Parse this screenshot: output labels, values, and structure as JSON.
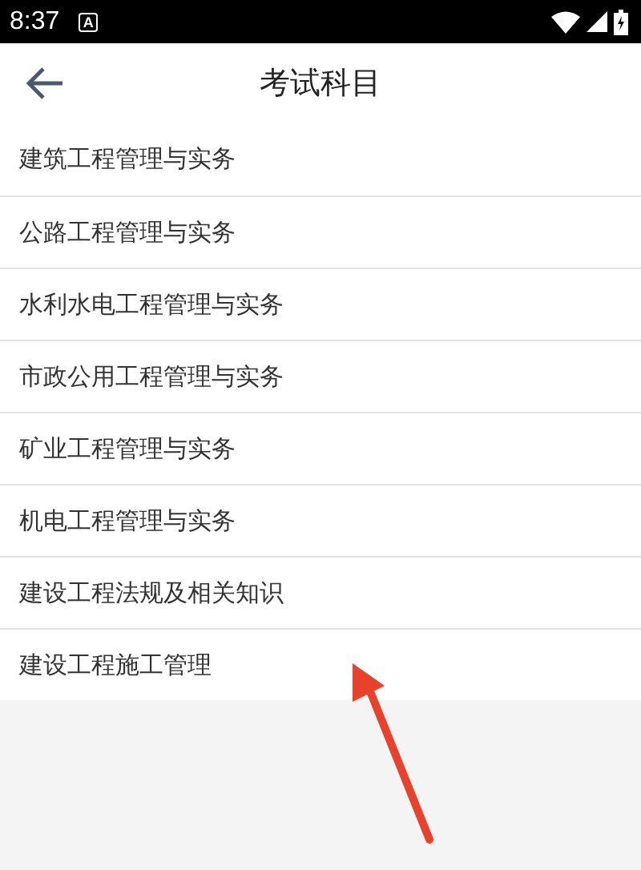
{
  "status_bar": {
    "time": "8:37",
    "notification": "A"
  },
  "header": {
    "title": "考试科目"
  },
  "subjects": [
    {
      "label": "建筑工程管理与实务"
    },
    {
      "label": "公路工程管理与实务"
    },
    {
      "label": "水利水电工程管理与实务"
    },
    {
      "label": "市政公用工程管理与实务"
    },
    {
      "label": "矿业工程管理与实务"
    },
    {
      "label": "机电工程管理与实务"
    },
    {
      "label": "建设工程法规及相关知识"
    },
    {
      "label": "建设工程施工管理"
    }
  ]
}
